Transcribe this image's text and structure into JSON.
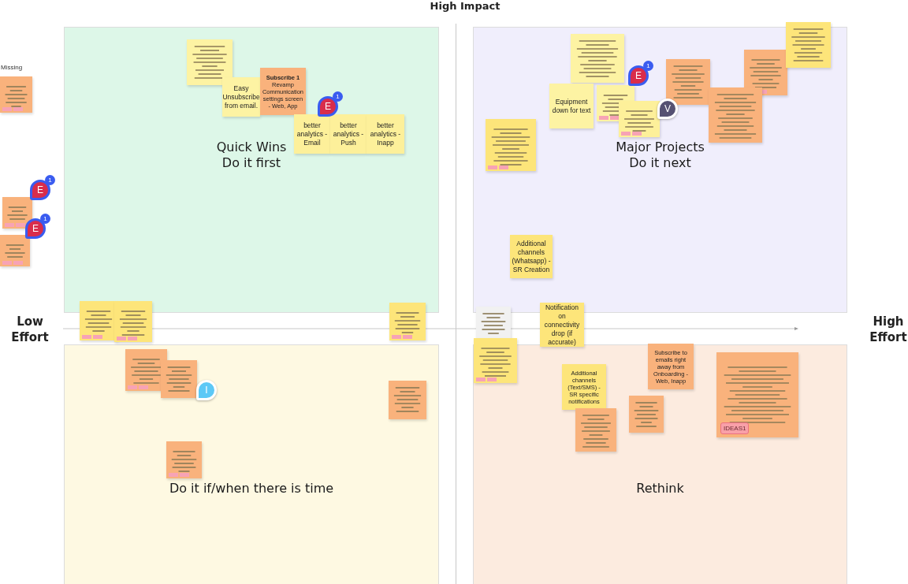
{
  "axis_labels": {
    "top": "High Impact",
    "left": "Low Effort",
    "right": "High Effort"
  },
  "side_label": "Missing",
  "quadrants": [
    {
      "title": "Quick Wins",
      "subtitle": "Do it first",
      "color": "#ddf7e8"
    },
    {
      "title": "Major Projects",
      "subtitle": "Do it next",
      "color": "#f0eefc"
    },
    {
      "title": "Do it if/when there is time",
      "color": "#fef9e2"
    },
    {
      "title": "Rethink",
      "color": "#fcebdf"
    }
  ],
  "notes": [
    {
      "kind": "lines",
      "color": "#fdf3a3",
      "tagged": false
    },
    {
      "kind": "text",
      "color": "#fdf3a3",
      "text": "Easy Unsubscribe from email.",
      "tagged": false
    },
    {
      "kind": "text",
      "color": "#f9b27c",
      "text": "**Subscribe 1** Revamp Communication settings screen - Web, App",
      "tagged": false
    },
    {
      "kind": "text",
      "color": "#fdf09a",
      "text": "better analytics - Email",
      "tagged": false
    },
    {
      "kind": "text",
      "color": "#fdf09a",
      "text": "better analytics - Push",
      "tagged": false
    },
    {
      "kind": "text",
      "color": "#fdf09a",
      "text": "better analytics - Inapp",
      "tagged": false
    },
    {
      "kind": "lines",
      "color": "#f9b27c",
      "tagged": true
    },
    {
      "kind": "lines",
      "color": "#f9b27c",
      "tagged": true
    },
    {
      "kind": "lines",
      "color": "#f9b27c",
      "tagged": true
    },
    {
      "kind": "lines",
      "color": "#fde57a",
      "tagged": true
    },
    {
      "kind": "lines",
      "color": "#fde57a",
      "tagged": true
    },
    {
      "kind": "lines",
      "color": "#fde57a",
      "tagged": true
    },
    {
      "kind": "lines",
      "color": "#fdf3a3",
      "tagged": false
    },
    {
      "kind": "text",
      "color": "#fdf3a3",
      "text": "Equipment down for text",
      "tagged": false
    },
    {
      "kind": "lines",
      "color": "#fdf3a3",
      "tagged": true
    },
    {
      "kind": "lines",
      "color": "#fde57a",
      "tagged": true
    },
    {
      "kind": "lines",
      "color": "#fdf09a",
      "tagged": true
    },
    {
      "kind": "lines",
      "color": "#f9b27c",
      "tagged": false
    },
    {
      "kind": "lines",
      "color": "#f9b27c",
      "tagged": true
    },
    {
      "kind": "lines",
      "color": "#f9b27c",
      "tagged": false
    },
    {
      "kind": "lines",
      "color": "#fde57a",
      "tagged": false
    },
    {
      "kind": "text",
      "color": "#fde57a",
      "text": "Additional channels (Whatsapp) - SR Creation",
      "tagged": false
    },
    {
      "kind": "lines",
      "color": "#f1f1f1",
      "tagged": false
    },
    {
      "kind": "text",
      "color": "#fde57a",
      "text": "Notification on connectivity drop (if accurate)",
      "tagged": false
    },
    {
      "kind": "lines",
      "color": "#fde57a",
      "tagged": true
    },
    {
      "kind": "text",
      "color": "#fde57a",
      "text": "Additional channels (Text/SMS) - SR specific notifications",
      "tagged": false
    },
    {
      "kind": "text",
      "color": "#f9b27c",
      "text": "Subscribe to emails right away from Onboarding - Web, Inapp",
      "tagged": false
    },
    {
      "kind": "lines",
      "color": "#f9b27c",
      "tagged": false
    },
    {
      "kind": "lines",
      "color": "#f9b27c",
      "tagged": false
    },
    {
      "kind": "lines",
      "color": "#f9b27c",
      "tagged": false,
      "tag": "IDEAS1"
    },
    {
      "kind": "lines",
      "color": "#f9b27c",
      "tagged": true
    },
    {
      "kind": "lines",
      "color": "#f9b27c",
      "tagged": false
    },
    {
      "kind": "lines",
      "color": "#f9b27c",
      "tagged": false
    },
    {
      "kind": "lines",
      "color": "#f9b27c",
      "tagged": true
    }
  ],
  "avatars": [
    {
      "initial": "E",
      "badge": "1",
      "color": "#d92d4b"
    },
    {
      "initial": "E",
      "badge": "1",
      "color": "#d92d4b"
    },
    {
      "initial": "E",
      "badge": "1",
      "color": "#d92d4b"
    },
    {
      "initial": "E",
      "badge": "1",
      "color": "#d92d4b"
    },
    {
      "initial": "V",
      "color": "#555172"
    },
    {
      "initial": "I",
      "color": "#5cc8f6"
    }
  ]
}
